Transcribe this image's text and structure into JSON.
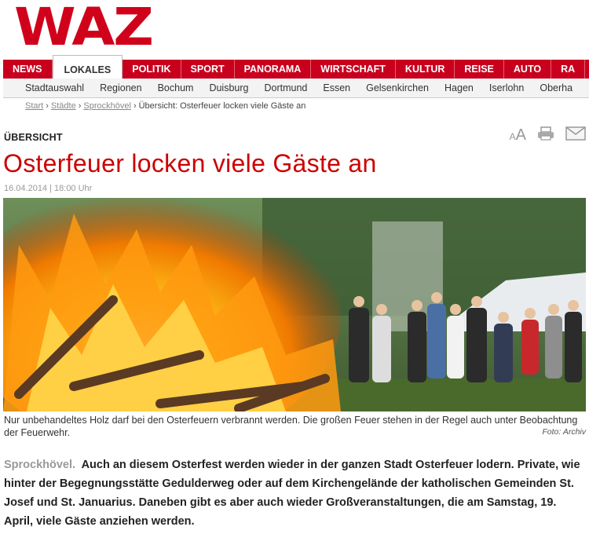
{
  "brand": {
    "logo_text": "WAZ",
    "accent": "#c8001e"
  },
  "main_nav": [
    {
      "label": "NEWS",
      "active": false
    },
    {
      "label": "LOKALES",
      "active": true
    },
    {
      "label": "POLITIK",
      "active": false
    },
    {
      "label": "SPORT",
      "active": false
    },
    {
      "label": "PANORAMA",
      "active": false
    },
    {
      "label": "WIRTSCHAFT",
      "active": false
    },
    {
      "label": "KULTUR",
      "active": false
    },
    {
      "label": "REISE",
      "active": false
    },
    {
      "label": "AUTO",
      "active": false
    },
    {
      "label": "RA",
      "active": false
    }
  ],
  "sub_nav": [
    "Stadtauswahl",
    "Regionen",
    "Bochum",
    "Duisburg",
    "Dortmund",
    "Essen",
    "Gelsenkirchen",
    "Hagen",
    "Iserlohn",
    "Oberha"
  ],
  "breadcrumb": {
    "links": [
      "Start",
      "Städte",
      "Sprockhövel"
    ],
    "current": "Übersicht: Osterfeuer locken viele Gäste an"
  },
  "article": {
    "kicker": "ÜBERSICHT",
    "headline": "Osterfeuer locken viele Gäste an",
    "dateline": "16.04.2014 | 18:00 Uhr",
    "caption": "Nur unbehandeltes Holz darf bei den Osterfeuern verbrannt werden. Die großen Feuer stehen in der Regel auch unter Beobachtung der Feuerwehr.",
    "credit": "Foto: Archiv",
    "location": "Sprockhövel.",
    "teaser": "Auch an diesem Osterfest werden wieder in der ganzen Stadt Osterfeuer lodern. Private, wie hinter der Begegnungsstätte Gedulderweg oder auf dem Kirchengelände der katholischen Gemeinden St. Josef und St. Januarius. Daneben gibt es aber auch wieder Großveranstaltungen, die am Samstag, 19. April, viele Gäste anziehen werden."
  },
  "tools": {
    "font_small": "A",
    "font_large": "A",
    "icons": [
      "print-icon",
      "mail-icon"
    ]
  }
}
